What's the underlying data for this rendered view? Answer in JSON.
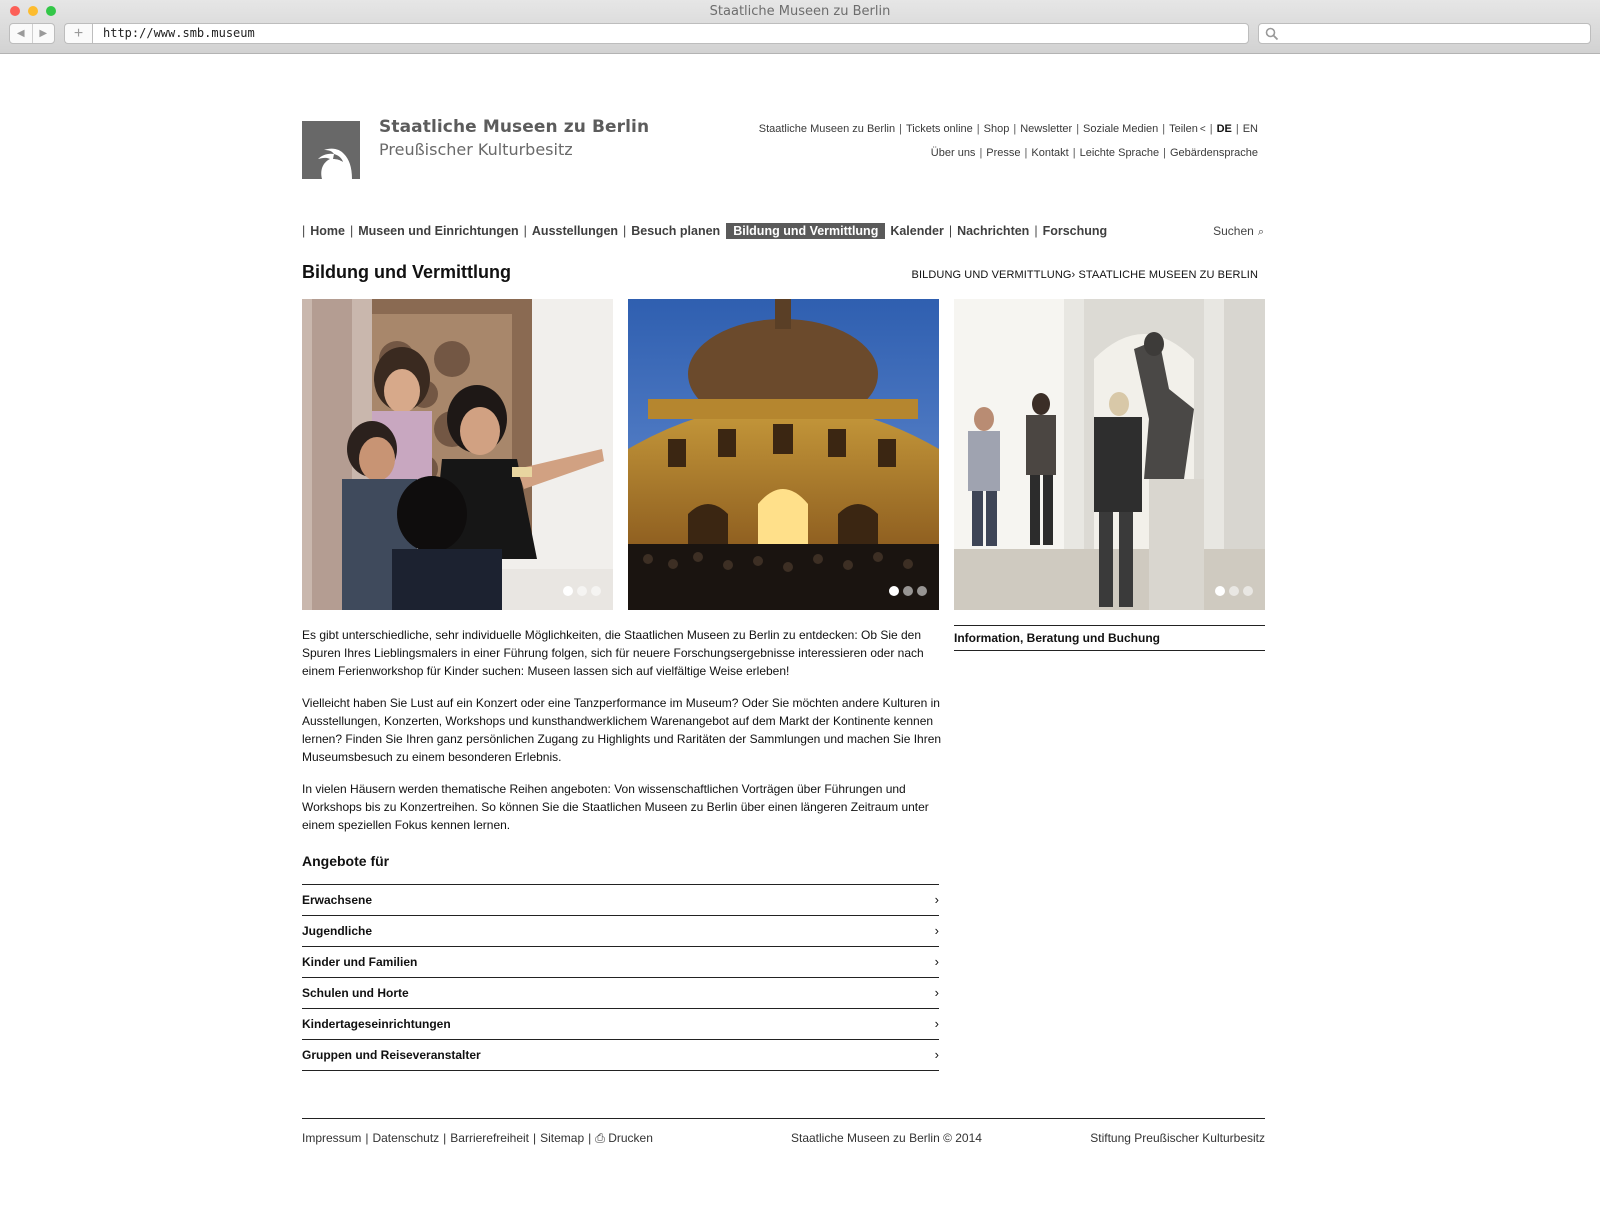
{
  "browser": {
    "window_title": "Staatliche Museen zu Berlin",
    "url": "http://www.smb.museum"
  },
  "brand": {
    "line1": "Staatliche Museen zu Berlin",
    "line2": "Preußischer Kulturbesitz",
    "logo_icon": "eagle-logo"
  },
  "toplinks": {
    "row1": [
      "Staatliche Museen zu Berlin",
      "Tickets online",
      "Shop",
      "Newsletter",
      "Soziale Medien",
      "Teilen"
    ],
    "lang": [
      "DE",
      "EN"
    ],
    "row2": [
      "Über uns",
      "Presse",
      "Kontakt",
      "Leichte Sprache",
      "Gebärdensprache"
    ]
  },
  "mainnav": {
    "items": [
      "Home",
      "Museen und Einrichtungen",
      "Ausstellungen",
      "Besuch planen",
      "Bildung und Vermittlung",
      "Kalender",
      "Nachrichten",
      "Forschung"
    ],
    "active": "Bildung und Vermittlung",
    "search_label": "Suchen"
  },
  "page": {
    "title": "Bildung und Vermittlung",
    "breadcrumb": [
      "Bildung und Vermittlung",
      "Staatliche Museen zu Berlin"
    ]
  },
  "images": [
    {
      "description_icon": "workshop-photo"
    },
    {
      "description_icon": "bode-museum-photo"
    },
    {
      "description_icon": "sculpture-gallery-photo"
    }
  ],
  "sidebar": {
    "box_title": "Information, Beratung und Buchung"
  },
  "intro": {
    "p1": "Es gibt unterschiedliche, sehr individuelle Möglichkeiten, die Staatlichen Museen zu Berlin zu entdecken: Ob Sie den Spuren Ihres Lieblingsmalers in einer Führung folgen, sich für neuere Forschungsergebnisse interessieren oder nach einem Ferienworkshop für Kinder suchen: Museen lassen sich auf vielfältige Weise erleben!",
    "p2": "Vielleicht haben Sie Lust auf ein Konzert oder eine Tanzperformance im Museum? Oder Sie möchten andere Kulturen in Ausstellungen, Konzerten, Workshops und kunsthandwerklichem Warenangebot auf dem Markt der Kontinente kennen lernen? Finden Sie Ihren ganz persönlichen Zugang zu Highlights und Raritäten der Sammlungen und machen Sie Ihren Museumsbesuch zu einem besonderen Erlebnis.",
    "p3": "In vielen Häusern werden thematische Reihen angeboten: Von wissenschaftlichen Vorträgen über Führungen und Workshops bis zu Konzertreihen. So können Sie die Staatlichen Museen zu Berlin über einen längeren Zeitraum unter einem speziellen Fokus kennen lernen."
  },
  "offers": {
    "heading": "Angebote für",
    "items": [
      "Erwachsene",
      "Jugendliche",
      "Kinder und Familien",
      "Schulen und Horte",
      "Kindertageseinrichtungen",
      "Gruppen und Reiseveranstalter"
    ]
  },
  "footer": {
    "links": [
      "Impressum",
      "Datenschutz",
      "Barrierefreiheit",
      "Sitemap",
      "Drucken"
    ],
    "copyright": "Staatliche Museen zu Berlin © 2014",
    "right": "Stiftung Preußischer Kulturbesitz"
  },
  "colors": {
    "nav_active_bg": "#5a5a5a",
    "logo_bg": "#686868"
  }
}
